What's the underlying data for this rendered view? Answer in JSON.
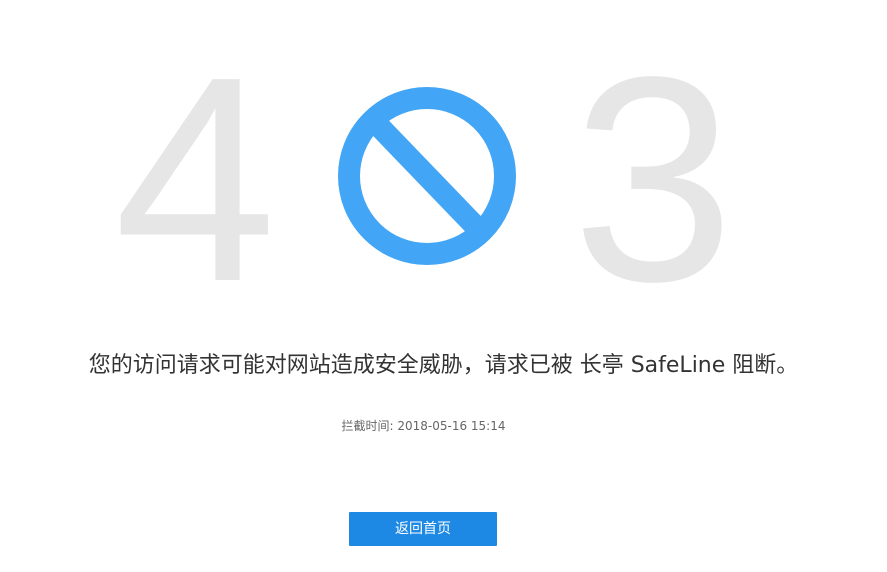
{
  "error_code": {
    "first_digit": "4",
    "last_digit": "3",
    "middle_icon": "block-icon",
    "digit_color": "#e6e6e6",
    "icon_color": "#42a5f5"
  },
  "message": "您的访问请求可能对网站造成安全威胁，请求已被 长亭 SafeLine 阻断。",
  "intercept_time": {
    "label": "拦截时间:",
    "value": "2018-05-16 15:14"
  },
  "home_button": {
    "label": "返回首页",
    "color": "#1e88e5"
  }
}
